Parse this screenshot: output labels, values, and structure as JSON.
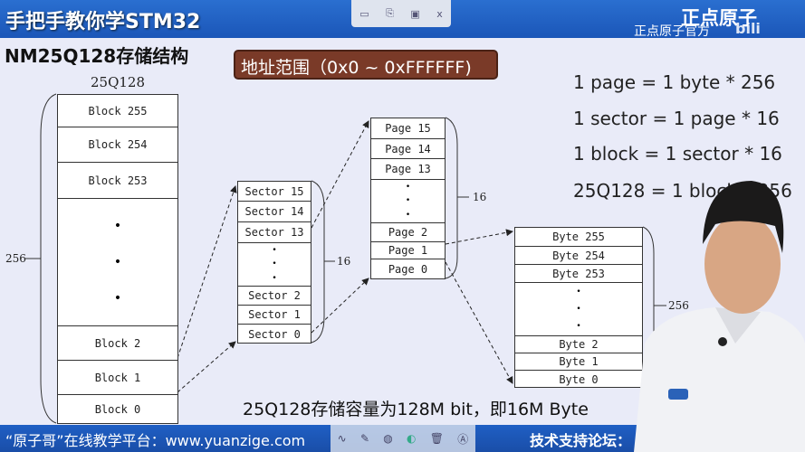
{
  "header": {
    "title": "手把手教你学STM32",
    "logo": "正点原子",
    "channel": "正点原子官方",
    "platform_mark": "bilibili"
  },
  "player_toolbar_top": {
    "icons": [
      "minimize-icon",
      "copy-icon",
      "save-icon",
      "close-icon"
    ],
    "close_label": "x"
  },
  "slide": {
    "heading": "NM25Q128存储结构",
    "address_range": "地址范围（0x0 ~ 0xFFFFFF)",
    "chip_label": "25Q128",
    "blocks": {
      "items": [
        "Block 255",
        "Block 254",
        "Block 253",
        "Block 2",
        "Block 1",
        "Block 0"
      ],
      "count_label": "256"
    },
    "sectors": {
      "items": [
        "Sector 15",
        "Sector 14",
        "Sector 13",
        "Sector 2",
        "Sector 1",
        "Sector 0"
      ],
      "count_label": "16"
    },
    "pages": {
      "items": [
        "Page 15",
        "Page 14",
        "Page 13",
        "Page 2",
        "Page 1",
        "Page 0"
      ],
      "count_label": "16"
    },
    "bytes": {
      "items": [
        "Byte 255",
        "Byte 254",
        "Byte 253",
        "Byte 2",
        "Byte 1",
        "Byte 0"
      ],
      "count_label": "256"
    },
    "formulas": [
      "1 page = 1 byte * 256",
      "1 sector = 1 page * 16",
      "1 block = 1 sector * 16",
      "25Q128 = 1 block * 256"
    ],
    "summary": "25Q128存储容量为128M bit，即16M Byte"
  },
  "footer": {
    "platform": "“原子哥”在线教学平台：www.yuanzige.com",
    "forum": "技术支持论坛："
  },
  "player_toolbar_bottom": {
    "icons": [
      "pen-icon",
      "marker-icon",
      "eraser-icon",
      "color-icon",
      "trash-icon",
      "text-icon"
    ]
  },
  "colors": {
    "bar": "#1f5fc4",
    "range_box": "#7a3a28",
    "background": "#e9ebf8"
  }
}
